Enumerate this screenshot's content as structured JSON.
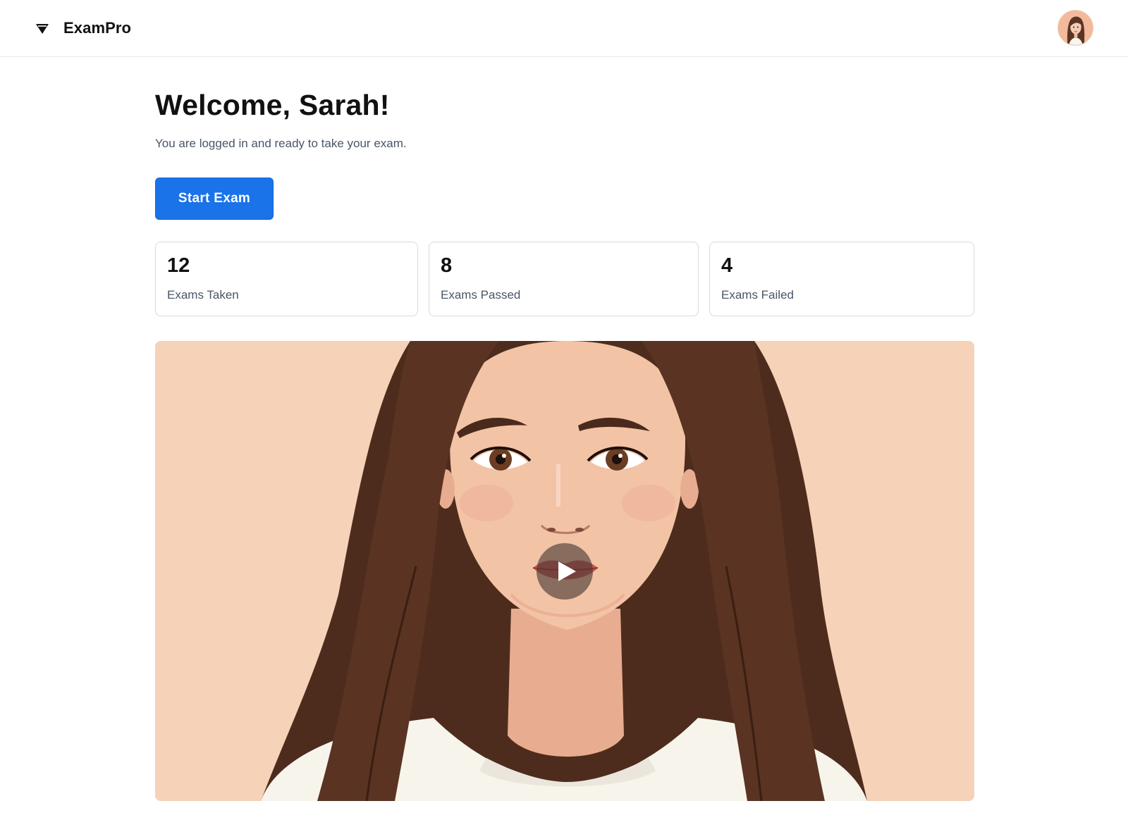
{
  "header": {
    "brand_name": "ExamPro",
    "brand_icon": "diamond-logo-icon",
    "avatar_icon": "user-avatar"
  },
  "main": {
    "welcome_title": "Welcome, Sarah!",
    "subtitle": "You are logged in and ready to take your exam.",
    "start_button_label": "Start Exam"
  },
  "stats": [
    {
      "value": "12",
      "label": "Exams Taken"
    },
    {
      "value": "8",
      "label": "Exams Passed"
    },
    {
      "value": "4",
      "label": "Exams Failed"
    }
  ],
  "video": {
    "play_icon": "play-icon"
  },
  "colors": {
    "accent": "#1a73e8",
    "text_primary": "#111111",
    "text_secondary": "#4a5668",
    "border": "#d6dae0",
    "video_background": "#f6d2b8"
  }
}
